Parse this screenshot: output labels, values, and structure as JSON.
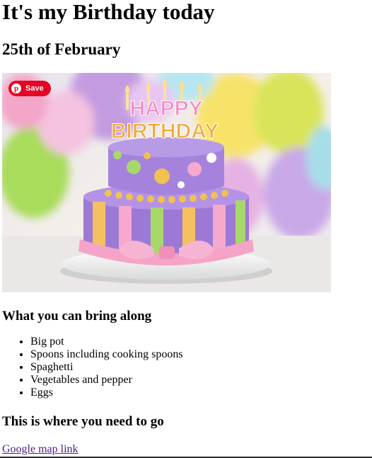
{
  "heading": "It's my Birthday today",
  "date": "25th of February",
  "image": {
    "topper_line1": "HAPPY",
    "topper_line2": "BIRTHDAY",
    "save_label": "Save",
    "save_color": "#e60023"
  },
  "bring_heading": "What you can bring along",
  "bring_items": [
    "Big pot",
    "Spoons including cooking spoons",
    "Spaghetti",
    "Vegetables and pepper",
    "Eggs"
  ],
  "location_heading": "This is where you need to go",
  "map_link_text": "Google map link"
}
